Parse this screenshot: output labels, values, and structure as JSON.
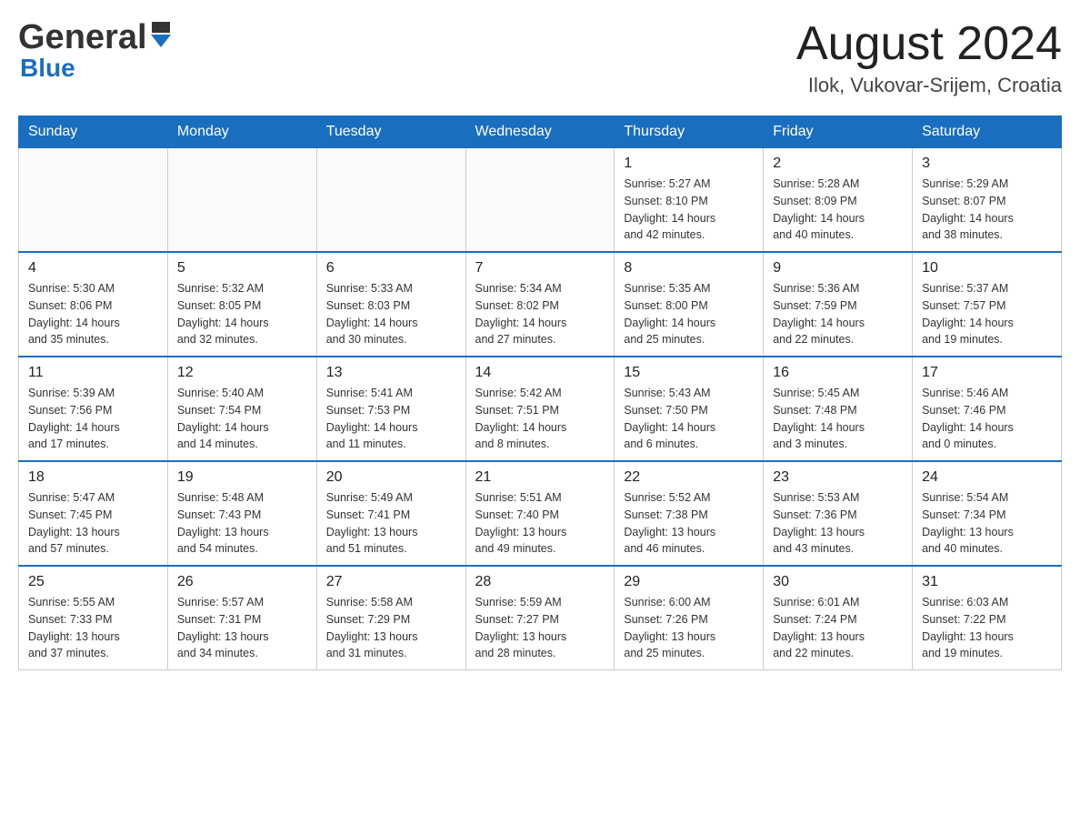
{
  "header": {
    "title": "August 2024",
    "subtitle": "Ilok, Vukovar-Srijem, Croatia",
    "logo_general": "General",
    "logo_blue": "Blue"
  },
  "days_of_week": [
    "Sunday",
    "Monday",
    "Tuesday",
    "Wednesday",
    "Thursday",
    "Friday",
    "Saturday"
  ],
  "weeks": [
    {
      "days": [
        {
          "number": "",
          "info": ""
        },
        {
          "number": "",
          "info": ""
        },
        {
          "number": "",
          "info": ""
        },
        {
          "number": "",
          "info": ""
        },
        {
          "number": "1",
          "info": "Sunrise: 5:27 AM\nSunset: 8:10 PM\nDaylight: 14 hours\nand 42 minutes."
        },
        {
          "number": "2",
          "info": "Sunrise: 5:28 AM\nSunset: 8:09 PM\nDaylight: 14 hours\nand 40 minutes."
        },
        {
          "number": "3",
          "info": "Sunrise: 5:29 AM\nSunset: 8:07 PM\nDaylight: 14 hours\nand 38 minutes."
        }
      ]
    },
    {
      "days": [
        {
          "number": "4",
          "info": "Sunrise: 5:30 AM\nSunset: 8:06 PM\nDaylight: 14 hours\nand 35 minutes."
        },
        {
          "number": "5",
          "info": "Sunrise: 5:32 AM\nSunset: 8:05 PM\nDaylight: 14 hours\nand 32 minutes."
        },
        {
          "number": "6",
          "info": "Sunrise: 5:33 AM\nSunset: 8:03 PM\nDaylight: 14 hours\nand 30 minutes."
        },
        {
          "number": "7",
          "info": "Sunrise: 5:34 AM\nSunset: 8:02 PM\nDaylight: 14 hours\nand 27 minutes."
        },
        {
          "number": "8",
          "info": "Sunrise: 5:35 AM\nSunset: 8:00 PM\nDaylight: 14 hours\nand 25 minutes."
        },
        {
          "number": "9",
          "info": "Sunrise: 5:36 AM\nSunset: 7:59 PM\nDaylight: 14 hours\nand 22 minutes."
        },
        {
          "number": "10",
          "info": "Sunrise: 5:37 AM\nSunset: 7:57 PM\nDaylight: 14 hours\nand 19 minutes."
        }
      ]
    },
    {
      "days": [
        {
          "number": "11",
          "info": "Sunrise: 5:39 AM\nSunset: 7:56 PM\nDaylight: 14 hours\nand 17 minutes."
        },
        {
          "number": "12",
          "info": "Sunrise: 5:40 AM\nSunset: 7:54 PM\nDaylight: 14 hours\nand 14 minutes."
        },
        {
          "number": "13",
          "info": "Sunrise: 5:41 AM\nSunset: 7:53 PM\nDaylight: 14 hours\nand 11 minutes."
        },
        {
          "number": "14",
          "info": "Sunrise: 5:42 AM\nSunset: 7:51 PM\nDaylight: 14 hours\nand 8 minutes."
        },
        {
          "number": "15",
          "info": "Sunrise: 5:43 AM\nSunset: 7:50 PM\nDaylight: 14 hours\nand 6 minutes."
        },
        {
          "number": "16",
          "info": "Sunrise: 5:45 AM\nSunset: 7:48 PM\nDaylight: 14 hours\nand 3 minutes."
        },
        {
          "number": "17",
          "info": "Sunrise: 5:46 AM\nSunset: 7:46 PM\nDaylight: 14 hours\nand 0 minutes."
        }
      ]
    },
    {
      "days": [
        {
          "number": "18",
          "info": "Sunrise: 5:47 AM\nSunset: 7:45 PM\nDaylight: 13 hours\nand 57 minutes."
        },
        {
          "number": "19",
          "info": "Sunrise: 5:48 AM\nSunset: 7:43 PM\nDaylight: 13 hours\nand 54 minutes."
        },
        {
          "number": "20",
          "info": "Sunrise: 5:49 AM\nSunset: 7:41 PM\nDaylight: 13 hours\nand 51 minutes."
        },
        {
          "number": "21",
          "info": "Sunrise: 5:51 AM\nSunset: 7:40 PM\nDaylight: 13 hours\nand 49 minutes."
        },
        {
          "number": "22",
          "info": "Sunrise: 5:52 AM\nSunset: 7:38 PM\nDaylight: 13 hours\nand 46 minutes."
        },
        {
          "number": "23",
          "info": "Sunrise: 5:53 AM\nSunset: 7:36 PM\nDaylight: 13 hours\nand 43 minutes."
        },
        {
          "number": "24",
          "info": "Sunrise: 5:54 AM\nSunset: 7:34 PM\nDaylight: 13 hours\nand 40 minutes."
        }
      ]
    },
    {
      "days": [
        {
          "number": "25",
          "info": "Sunrise: 5:55 AM\nSunset: 7:33 PM\nDaylight: 13 hours\nand 37 minutes."
        },
        {
          "number": "26",
          "info": "Sunrise: 5:57 AM\nSunset: 7:31 PM\nDaylight: 13 hours\nand 34 minutes."
        },
        {
          "number": "27",
          "info": "Sunrise: 5:58 AM\nSunset: 7:29 PM\nDaylight: 13 hours\nand 31 minutes."
        },
        {
          "number": "28",
          "info": "Sunrise: 5:59 AM\nSunset: 7:27 PM\nDaylight: 13 hours\nand 28 minutes."
        },
        {
          "number": "29",
          "info": "Sunrise: 6:00 AM\nSunset: 7:26 PM\nDaylight: 13 hours\nand 25 minutes."
        },
        {
          "number": "30",
          "info": "Sunrise: 6:01 AM\nSunset: 7:24 PM\nDaylight: 13 hours\nand 22 minutes."
        },
        {
          "number": "31",
          "info": "Sunrise: 6:03 AM\nSunset: 7:22 PM\nDaylight: 13 hours\nand 19 minutes."
        }
      ]
    }
  ]
}
